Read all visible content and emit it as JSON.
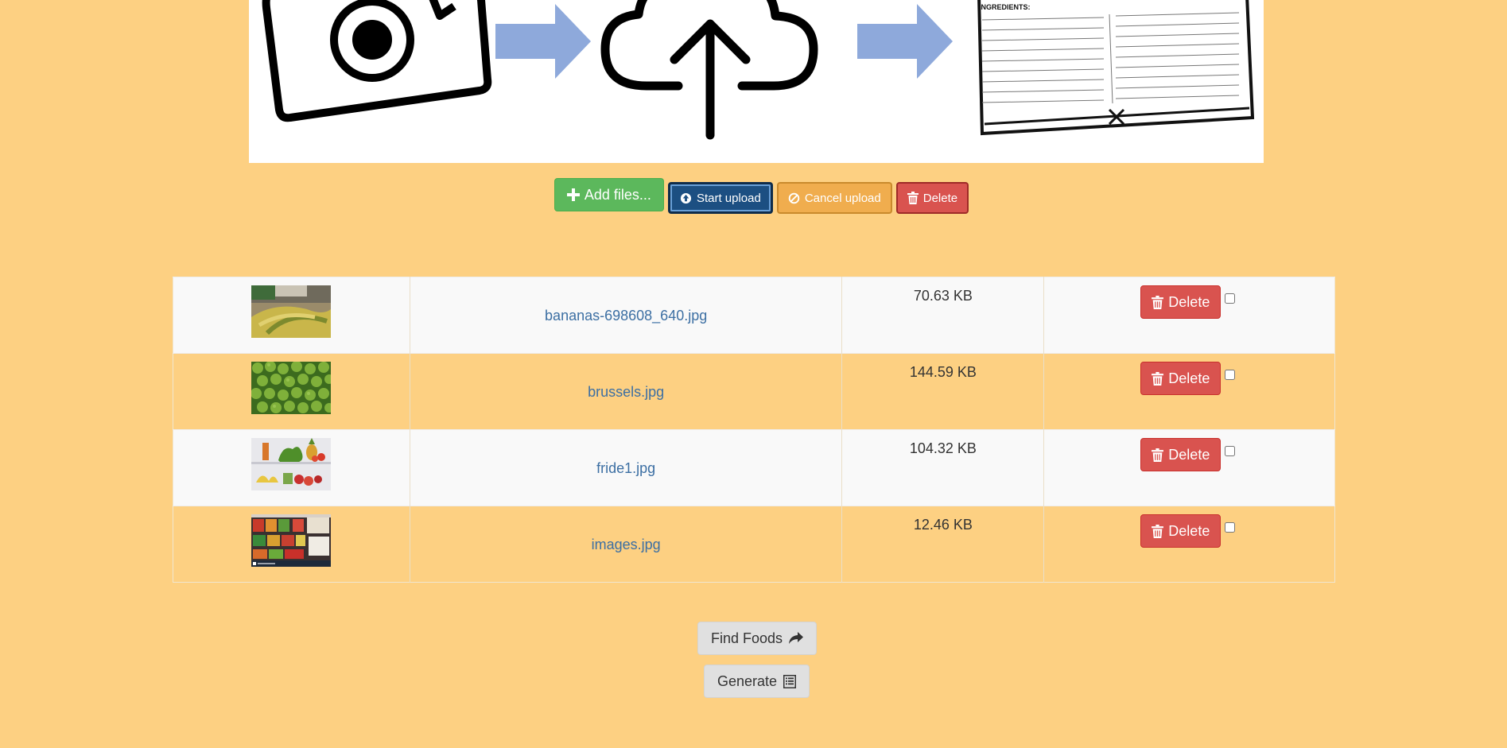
{
  "colors": {
    "page_background": "#fdd082",
    "add_files": "#5cb85c",
    "start_upload": "#1c4f82",
    "cancel_upload": "#f0ad4e",
    "delete": "#d9534f",
    "link": "#3c6fa3"
  },
  "banner": {
    "ingredients_label": "INGREDIENTS:"
  },
  "toolbar": {
    "add_files_label": "Add files...",
    "start_upload_label": "Start upload",
    "cancel_upload_label": "Cancel upload",
    "delete_label": "Delete"
  },
  "files": [
    {
      "name": "bananas-698608_640.jpg",
      "size": "70.63 KB",
      "delete_label": "Delete",
      "thumb_icon": "bananas-thumbnail"
    },
    {
      "name": "brussels.jpg",
      "size": "144.59 KB",
      "delete_label": "Delete",
      "thumb_icon": "brussels-sprouts-thumbnail"
    },
    {
      "name": "fride1.jpg",
      "size": "104.32 KB",
      "delete_label": "Delete",
      "thumb_icon": "fridge-thumbnail"
    },
    {
      "name": "images.jpg",
      "size": "12.46 KB",
      "delete_label": "Delete",
      "thumb_icon": "fridge-shelves-thumbnail"
    }
  ],
  "actions": {
    "find_foods_label": "Find Foods",
    "generate_label": "Generate"
  }
}
